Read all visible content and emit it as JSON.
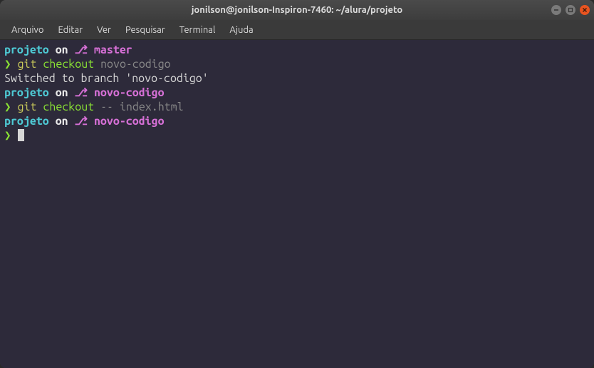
{
  "titlebar": {
    "title": "jonilson@jonilson-Inspiron-7460: ~/alura/projeto"
  },
  "menubar": {
    "items": [
      "Arquivo",
      "Editar",
      "Ver",
      "Pesquisar",
      "Terminal",
      "Ajuda"
    ]
  },
  "terminal": {
    "lines": [
      {
        "segments": [
          {
            "cls": "cyan",
            "text": "projeto"
          },
          {
            "cls": "white-bold",
            "text": " on "
          },
          {
            "cls": "magenta",
            "text": "⎇ master"
          }
        ]
      },
      {
        "segments": [
          {
            "cls": "green-bold",
            "text": "❯ "
          },
          {
            "cls": "yellow",
            "text": "git "
          },
          {
            "cls": "green",
            "text": "checkout "
          },
          {
            "cls": "grey",
            "text": "novo-codigo"
          }
        ]
      },
      {
        "segments": [
          {
            "cls": "",
            "text": "Switched to branch 'novo-codigo'"
          }
        ]
      },
      {
        "segments": [
          {
            "cls": "cyan",
            "text": "projeto"
          },
          {
            "cls": "white-bold",
            "text": " on "
          },
          {
            "cls": "magenta",
            "text": "⎇ novo-codigo"
          }
        ]
      },
      {
        "segments": [
          {
            "cls": "green-bold",
            "text": "❯ "
          },
          {
            "cls": "yellow",
            "text": "git "
          },
          {
            "cls": "green",
            "text": "checkout "
          },
          {
            "cls": "grey",
            "text": "-- index.html"
          }
        ]
      },
      {
        "segments": [
          {
            "cls": "cyan",
            "text": "projeto"
          },
          {
            "cls": "white-bold",
            "text": " on "
          },
          {
            "cls": "magenta",
            "text": "⎇ novo-codigo"
          }
        ]
      },
      {
        "segments": [
          {
            "cls": "green-bold",
            "text": "❯ "
          }
        ],
        "cursor": true
      }
    ]
  }
}
